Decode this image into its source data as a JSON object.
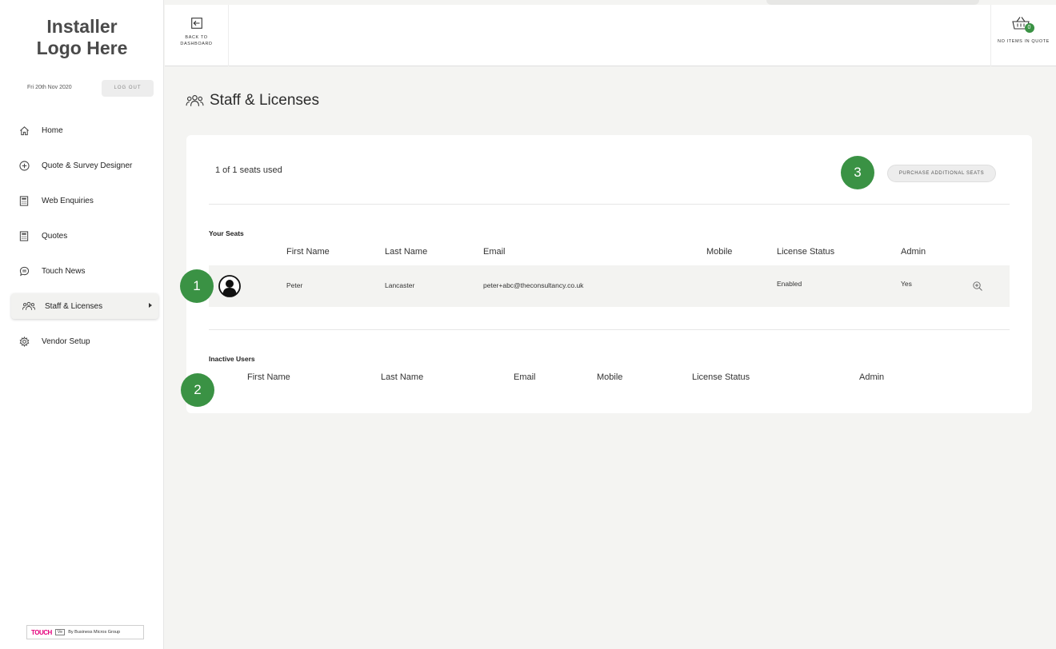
{
  "sidebar": {
    "logo_line1": "Installer",
    "logo_line2": "Logo Here",
    "date": "Fri 20th Nov 2020",
    "logout_label": "LOG OUT",
    "items": [
      {
        "label": "Home",
        "icon": "home-icon"
      },
      {
        "label": "Quote & Survey Designer",
        "icon": "plus-circle-icon"
      },
      {
        "label": "Web Enquiries",
        "icon": "calculator-icon"
      },
      {
        "label": "Quotes",
        "icon": "calculator-icon"
      },
      {
        "label": "Touch News",
        "icon": "chat-bubble-icon"
      },
      {
        "label": "Staff & Licenses",
        "icon": "users-icon",
        "active": true
      },
      {
        "label": "Vendor Setup",
        "icon": "gear-icon"
      }
    ],
    "footer": {
      "brand": "TOUCH",
      "tag": "Ve",
      "by": "By Business Micros Group"
    }
  },
  "topbar": {
    "back_label": "BACK TO DASHBOARD",
    "quote_count": "0",
    "quote_label": "NO ITEMS IN QUOTE"
  },
  "page": {
    "title": "Staff & Licenses"
  },
  "seats": {
    "used_text": "1 of 1 seats used",
    "purchase_label": "PURCHASE ADDITIONAL SEATS",
    "your_seats_title": "Your Seats",
    "columns": [
      "First Name",
      "Last Name",
      "Email",
      "Mobile",
      "License Status",
      "Admin"
    ],
    "rows": [
      {
        "first": "Peter",
        "last": "Lancaster",
        "email": "peter+abc@theconsultancy.co.uk",
        "mobile": "",
        "status": "Enabled",
        "admin": "Yes"
      }
    ]
  },
  "inactive": {
    "title": "Inactive Users",
    "columns": [
      "First Name",
      "Last Name",
      "Email",
      "Mobile",
      "License Status",
      "Admin"
    ]
  },
  "markers": [
    "1",
    "2",
    "3"
  ],
  "colors": {
    "accent": "#3a9244",
    "brand_pink": "#e4007c"
  }
}
